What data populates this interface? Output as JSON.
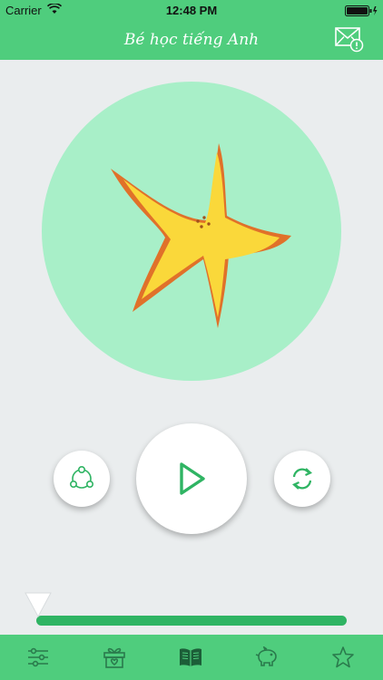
{
  "status_bar": {
    "carrier": "Carrier",
    "time": "12:48 PM"
  },
  "header": {
    "title": "Bé học tiếng Anh",
    "mail_icon": "mail-alert-icon"
  },
  "player": {
    "artwork": "starfish",
    "controls": {
      "share_icon": "share-icon",
      "play_icon": "play-icon",
      "repeat_icon": "repeat-icon"
    },
    "progress_fraction": 1.0
  },
  "tab_bar": {
    "tabs": [
      {
        "icon": "sliders-icon",
        "active": false
      },
      {
        "icon": "gift-box-icon",
        "active": false
      },
      {
        "icon": "book-icon",
        "active": true
      },
      {
        "icon": "piggy-bank-icon",
        "active": false
      },
      {
        "icon": "star-icon",
        "active": false
      }
    ]
  },
  "colors": {
    "primary": "#4fcd7d",
    "accent": "#2fb463",
    "circle": "#a8efc8",
    "background": "#eaedee"
  }
}
